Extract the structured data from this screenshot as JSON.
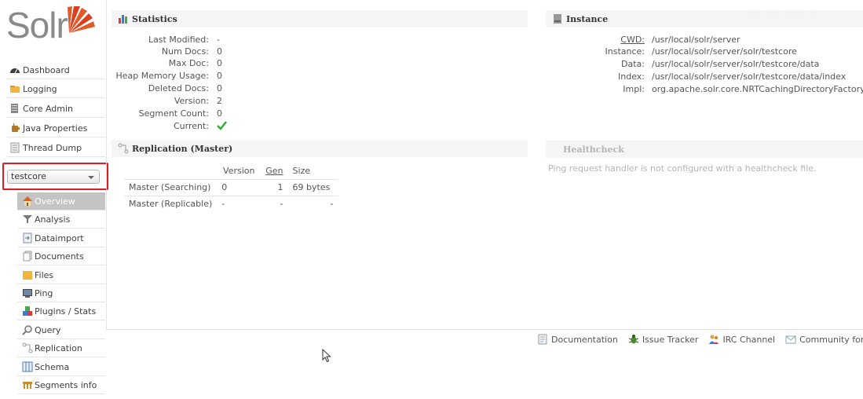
{
  "app": {
    "logo_text": "Solr"
  },
  "sidebar": {
    "items": [
      {
        "label": "Dashboard",
        "icon": "dashboard-icon"
      },
      {
        "label": "Logging",
        "icon": "logging-icon"
      },
      {
        "label": "Core Admin",
        "icon": "core-admin-icon"
      },
      {
        "label": "Java Properties",
        "icon": "java-properties-icon"
      },
      {
        "label": "Thread Dump",
        "icon": "thread-dump-icon"
      }
    ],
    "core_selector": {
      "selected": "testcore"
    },
    "core_menu": [
      {
        "label": "Overview",
        "icon": "home-icon",
        "active": true
      },
      {
        "label": "Analysis",
        "icon": "funnel-icon"
      },
      {
        "label": "Dataimport",
        "icon": "dataimport-icon"
      },
      {
        "label": "Documents",
        "icon": "documents-icon"
      },
      {
        "label": "Files",
        "icon": "folder-icon"
      },
      {
        "label": "Ping",
        "icon": "ping-icon"
      },
      {
        "label": "Plugins / Stats",
        "icon": "plugins-icon"
      },
      {
        "label": "Query",
        "icon": "magnifier-icon"
      },
      {
        "label": "Replication",
        "icon": "replication-icon"
      },
      {
        "label": "Schema",
        "icon": "schema-icon"
      },
      {
        "label": "Segments info",
        "icon": "segments-icon"
      }
    ]
  },
  "statistics": {
    "title": "Statistics",
    "rows": [
      {
        "label": "Last Modified:",
        "value": "-"
      },
      {
        "label": "Num Docs:",
        "value": "0"
      },
      {
        "label": "Max Doc:",
        "value": "0"
      },
      {
        "label": "Heap Memory Usage:",
        "value": "0"
      },
      {
        "label": "Deleted Docs:",
        "value": "0"
      },
      {
        "label": "Version:",
        "value": "2"
      },
      {
        "label": "Segment Count:",
        "value": "0"
      },
      {
        "label": "Current:",
        "value": ""
      }
    ]
  },
  "instance": {
    "title": "Instance",
    "rows": [
      {
        "label": "CWD:",
        "value": "/usr/local/solr/server"
      },
      {
        "label": "Instance:",
        "value": "/usr/local/solr/server/solr/testcore"
      },
      {
        "label": "Data:",
        "value": "/usr/local/solr/server/solr/testcore/data"
      },
      {
        "label": "Index:",
        "value": "/usr/local/solr/server/solr/testcore/data/index"
      },
      {
        "label": "Impl:",
        "value": "org.apache.solr.core.NRTCachingDirectoryFactory"
      }
    ]
  },
  "replication": {
    "title": "Replication (Master)",
    "columns": [
      "Version",
      "Gen",
      "Size"
    ],
    "rows": [
      {
        "name": "Master (Searching)",
        "version": "0",
        "gen": "1",
        "size": "69 bytes"
      },
      {
        "name": "Master (Replicable)",
        "version": "-",
        "gen": "-",
        "size": "-"
      }
    ]
  },
  "healthcheck": {
    "title": "Healthcheck",
    "message": "Ping request handler is not configured with a healthcheck file."
  },
  "footer": {
    "links": [
      {
        "label": "Documentation",
        "icon": "documentation-icon"
      },
      {
        "label": "Issue Tracker",
        "icon": "bug-icon"
      },
      {
        "label": "IRC Channel",
        "icon": "irc-icon"
      },
      {
        "label": "Community forur",
        "icon": "mail-icon"
      }
    ]
  }
}
